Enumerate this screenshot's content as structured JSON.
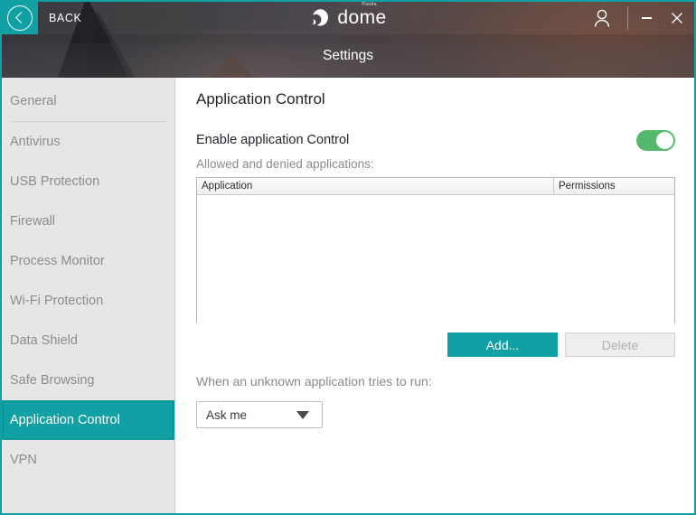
{
  "window": {
    "accent_color": "#11a0a4",
    "back_label": "BACK",
    "back_icon": "chevron-left-circle-icon",
    "user_icon": "user-account-icon",
    "minimize_icon": "minimize-icon",
    "close_icon": "close-icon",
    "close_glyph": "✕"
  },
  "brand": {
    "tiny": "Panda",
    "name": "dome",
    "mark_icon": "panda-logo-icon"
  },
  "header": {
    "title": "Settings"
  },
  "sidebar": {
    "items": [
      {
        "label": "General",
        "selected": false
      },
      {
        "label": "Antivirus",
        "selected": false
      },
      {
        "label": "USB Protection",
        "selected": false
      },
      {
        "label": "Firewall",
        "selected": false
      },
      {
        "label": "Process Monitor",
        "selected": false
      },
      {
        "label": "Wi-Fi Protection",
        "selected": false
      },
      {
        "label": "Data Shield",
        "selected": false
      },
      {
        "label": "Safe Browsing",
        "selected": false
      },
      {
        "label": "Application Control",
        "selected": true
      },
      {
        "label": "VPN",
        "selected": false
      }
    ]
  },
  "main": {
    "page_title": "Application Control",
    "enable_label": "Enable application Control",
    "enable_toggle": {
      "state": "on",
      "on_color": "#54b96b"
    },
    "list_label": "Allowed and denied applications:",
    "table": {
      "columns": [
        "Application",
        "Permissions"
      ],
      "rows": []
    },
    "add_button": "Add...",
    "delete_button": "Delete",
    "delete_disabled": true,
    "unknown_label": "When an unknown application tries to run:",
    "unknown_select": {
      "value": "Ask me",
      "caret_icon": "chevron-down-icon"
    }
  }
}
